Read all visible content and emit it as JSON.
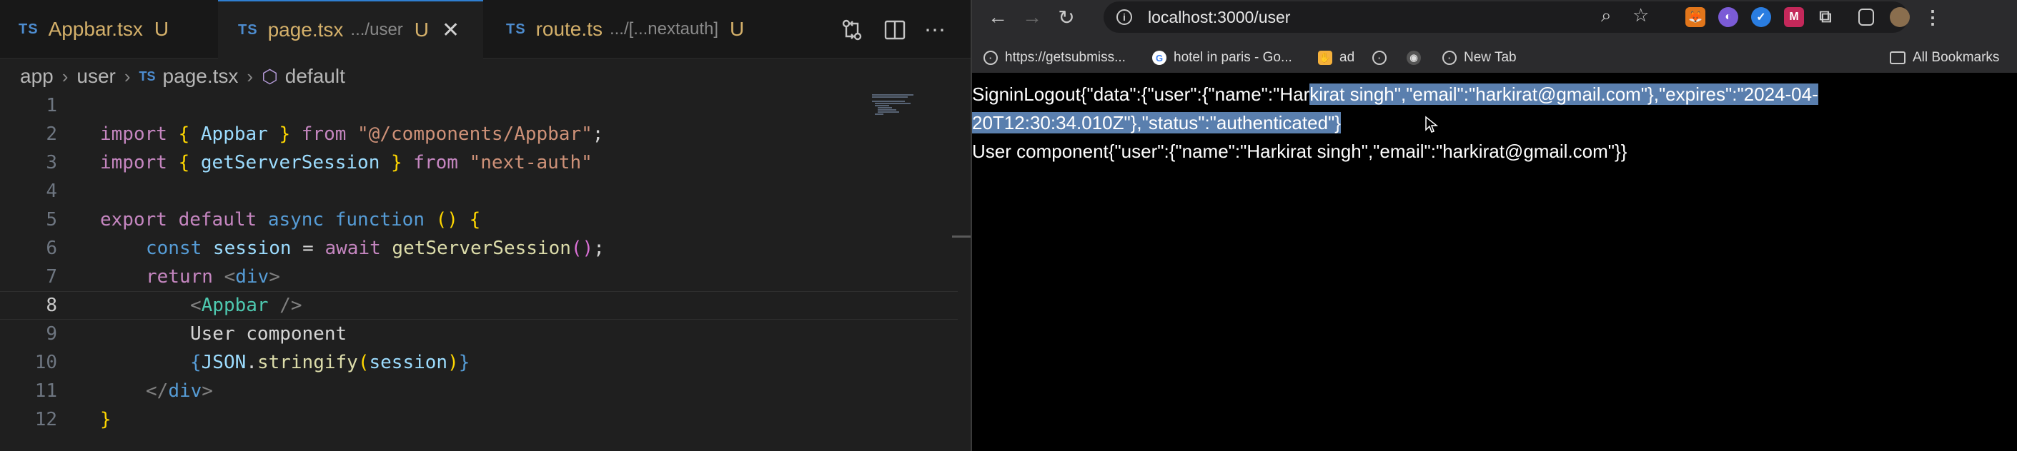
{
  "editor": {
    "tabs": [
      {
        "lang": "TS",
        "name": "Appbar.tsx",
        "dir": "",
        "status": "U"
      },
      {
        "lang": "TS",
        "name": "page.tsx",
        "dir": ".../user",
        "status": "U"
      },
      {
        "lang": "TS",
        "name": "route.ts",
        "dir": ".../[...nextauth]",
        "status": "U"
      }
    ],
    "active_tab": 1,
    "breadcrumb": {
      "p1": "app",
      "p2": "user",
      "lang": "TS",
      "file": "page.tsx",
      "symbol": "default"
    },
    "line_numbers": [
      "1",
      "2",
      "3",
      "4",
      "5",
      "6",
      "7",
      "8",
      "9",
      "10",
      "11",
      "12"
    ],
    "current_line": "8",
    "code": {
      "l2": {
        "kw1": "import",
        "b1": "{",
        "id": " Appbar ",
        "b2": "}",
        "kw2": " from ",
        "str": "\"@/components/Appbar\"",
        "end": ";"
      },
      "l3": {
        "kw1": "import",
        "b1": "{",
        "id": " getServerSession ",
        "b2": "}",
        "kw2": " from ",
        "str": "\"next-auth\""
      },
      "l5": {
        "kw1": "export",
        "kw2": " default ",
        "kw3": "async",
        "kw4": " function",
        "p1": " (",
        "p2": ")",
        "b": " {"
      },
      "l6": {
        "kw1": "const",
        "var": " session",
        "op": " = ",
        "kw2": "await",
        "fn": " getServerSession",
        "p": "()",
        "end": ";"
      },
      "l7": {
        "kw": "return",
        "t1": " <",
        "tn": "div",
        "t2": ">"
      },
      "l8": {
        "t1": "<",
        "tn": "Appbar",
        "t2": " />"
      },
      "l9": {
        "text": "User component"
      },
      "l10": {
        "b1": "{",
        "id": "JSON",
        "dot": ".",
        "fn": "stringify",
        "p1": "(",
        "var": "session",
        "p2": ")",
        "b2": "}"
      },
      "l11": {
        "t1": "</",
        "tn": "div",
        "t2": ">"
      },
      "l12": {
        "b": "}"
      }
    }
  },
  "browser": {
    "url": "localhost:3000/user",
    "bookmarks": [
      "https://getsubmiss...",
      "hotel in paris - Go...",
      "ad",
      "New Tab"
    ],
    "all_bookmarks": "All Bookmarks",
    "extensions": [
      "metamask",
      "fox",
      "shield",
      "M",
      "puzzle"
    ],
    "page": {
      "line1_pre": "SigninLogout{\"data\":{\"user\":{\"name\":\"Har",
      "line1_sel": "kirat singh\",\"email\":\"harkirat@gmail.com\"},\"expires\":\"2024-04-",
      "line2_sel": "20T12:30:34.010Z\"},\"status\":\"authenticated\"}",
      "line3": "User component{\"user\":{\"name\":\"Harkirat singh\",\"email\":\"harkirat@gmail.com\"}}"
    }
  }
}
